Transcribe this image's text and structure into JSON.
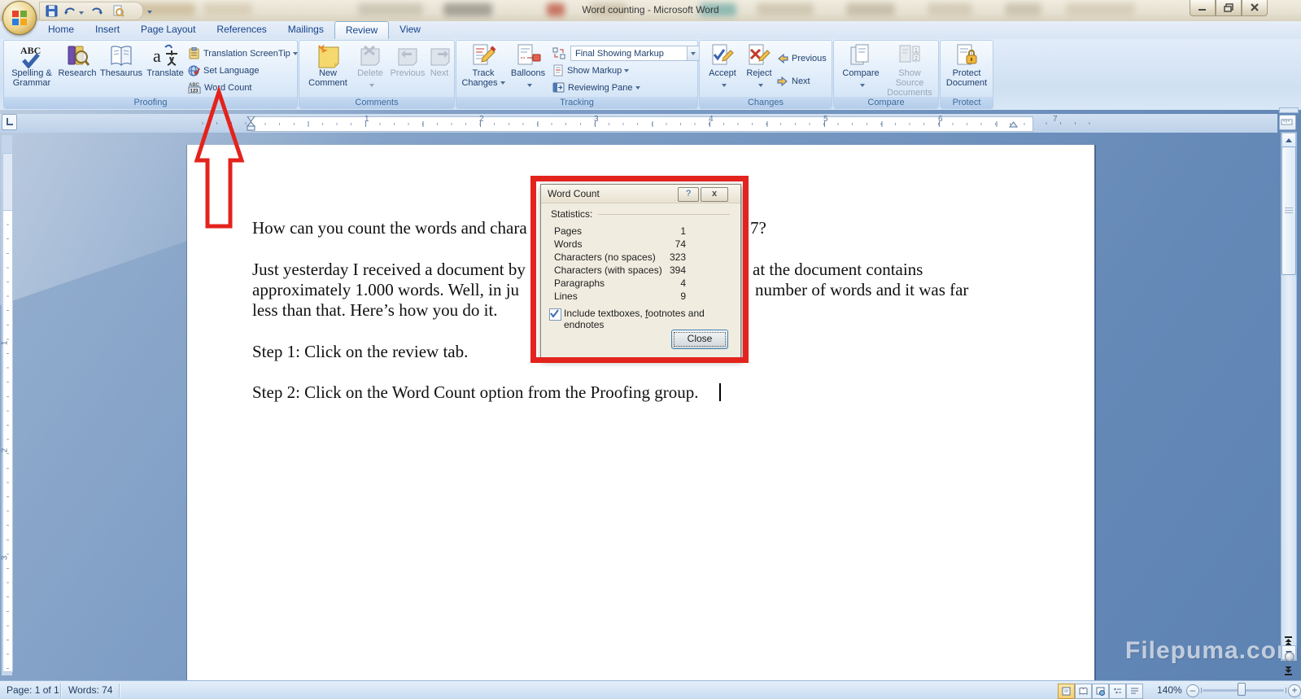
{
  "window": {
    "title": "Word counting - Microsoft Word"
  },
  "tabs": {
    "items": [
      "Home",
      "Insert",
      "Page Layout",
      "References",
      "Mailings",
      "Review",
      "View"
    ],
    "active": "Review"
  },
  "ribbon": {
    "proofing": {
      "caption": "Proofing",
      "spelling1": "Spelling &",
      "spelling2": "Grammar",
      "research": "Research",
      "thesaurus": "Thesaurus",
      "translate": "Translate",
      "screentip": "Translation ScreenTip",
      "set_language": "Set Language",
      "word_count": "Word Count"
    },
    "comments": {
      "caption": "Comments",
      "new1": "New",
      "new2": "Comment",
      "delete": "Delete",
      "previous": "Previous",
      "next": "Next"
    },
    "tracking": {
      "caption": "Tracking",
      "track1": "Track",
      "track2": "Changes",
      "balloons": "Balloons",
      "display_combo": "Final Showing Markup",
      "show_markup": "Show Markup",
      "reviewing_pane": "Reviewing Pane"
    },
    "changes": {
      "caption": "Changes",
      "accept": "Accept",
      "reject": "Reject",
      "previous": "Previous",
      "next": "Next"
    },
    "compare": {
      "caption": "Compare",
      "compare": "Compare",
      "source1": "Show Source",
      "source2": "Documents"
    },
    "protect": {
      "caption": "Protect",
      "protect1": "Protect",
      "protect2": "Document"
    }
  },
  "ruler": {
    "h": [
      "1",
      "2",
      "3",
      "4",
      "5",
      "6",
      "7"
    ],
    "v": [
      "1",
      "2",
      "3"
    ]
  },
  "document": {
    "line1_left": "How can you count the words and chara",
    "line1_right": "7?",
    "line2_left": "Just yesterday I received a document by",
    "line2_right": "at the document contains",
    "line3_left": "approximately 1.000 words. Well, in ju",
    "line3_right": "number of words and it was far",
    "line4": "less than that. Here’s how you do it.",
    "line5": "Step 1: Click on the review tab.",
    "line6": "Step 2: Click on the Word Count option from the Proofing group."
  },
  "dialog": {
    "title": "Word Count",
    "section": "Statistics:",
    "rows": [
      {
        "label": "Pages",
        "value": "1"
      },
      {
        "label": "Words",
        "value": "74"
      },
      {
        "label": "Characters (no spaces)",
        "value": "323"
      },
      {
        "label": "Characters (with spaces)",
        "value": "394"
      },
      {
        "label": "Paragraphs",
        "value": "4"
      },
      {
        "label": "Lines",
        "value": "9"
      }
    ],
    "checkbox_pre": "Include textboxes, ",
    "checkbox_u": "f",
    "checkbox_post": "ootnotes and endnotes",
    "close": "Close",
    "help_glyph": "?",
    "close_glyph": "x"
  },
  "status": {
    "page": "Page: 1 of 1",
    "words": "Words: 74",
    "zoom": "140%"
  },
  "watermark": "Filepuma.com",
  "icons": {
    "dropdown": "▾",
    "minus": "–",
    "plus": "+"
  },
  "colors": {
    "annotation_red": "#e3231d",
    "ribbon_text": "#1e3f6f",
    "caption_text": "#3e6b9e"
  }
}
